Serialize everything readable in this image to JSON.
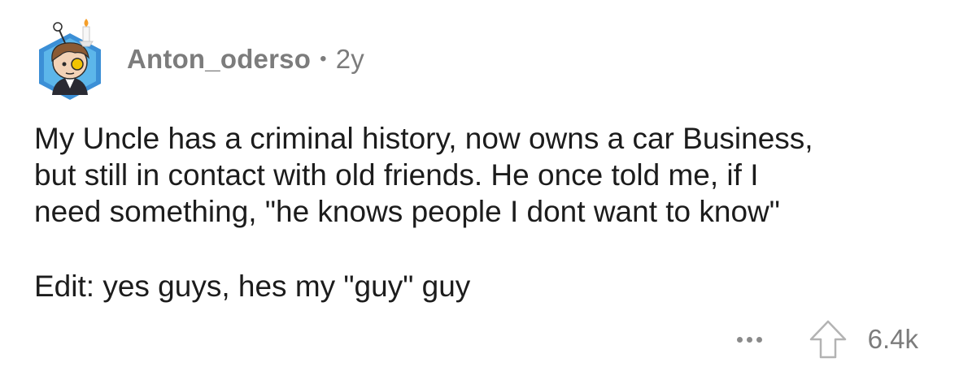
{
  "comment": {
    "author": "Anton_oderso",
    "separator": "•",
    "age": "2y",
    "body_lines": [
      "My Uncle has a criminal history, now owns a car Business,",
      "but still in contact with old friends. He once told me, if I",
      "need something, \"he knows people I dont want to know\""
    ],
    "edit": "Edit: yes guys, hes my \"guy\" guy",
    "score": "6.4k",
    "icons": {
      "avatar": "snoo-avatar-icon",
      "more": "more-dots-icon",
      "upvote": "upvote-arrow-icon"
    },
    "colors": {
      "meta_text": "#7c7c7c",
      "body_text": "#1c1c1c",
      "avatar_hex": "#3b8fd6"
    }
  }
}
